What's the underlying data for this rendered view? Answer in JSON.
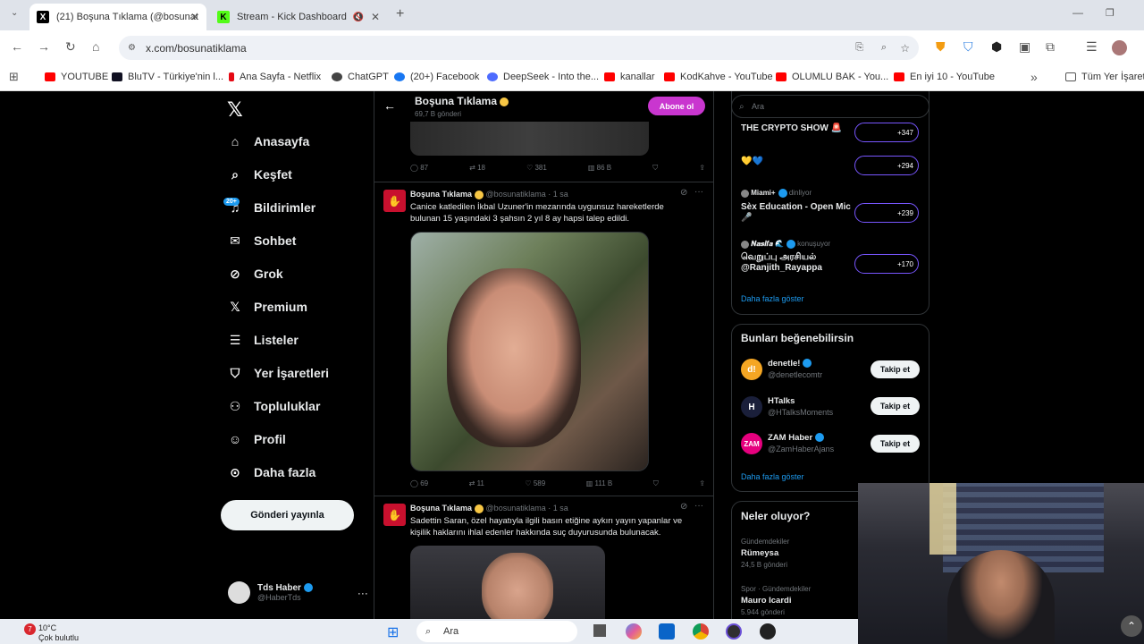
{
  "tabs": [
    {
      "title": "(21) Boşuna Tıklama (@bosunat",
      "active": true
    },
    {
      "title": "Stream - Kick Dashboard",
      "active": false
    }
  ],
  "url": "x.com/bosunatiklama",
  "bookmarks": [
    "YOUTUBE",
    "BluTV - Türkiye'nin l...",
    "Ana Sayfa - Netflix",
    "ChatGPT",
    "(20+) Facebook",
    "DeepSeek - Into the...",
    "kanallar",
    "KodKahve - YouTube",
    "OLUMLU BAK - You...",
    "En iyi 10 - YouTube",
    "Tüm Yer İşaretle"
  ],
  "nav": {
    "items": [
      "Anasayfa",
      "Keşfet",
      "Bildirimler",
      "Sohbet",
      "Grok",
      "Premium",
      "Listeler",
      "Yer İşaretleri",
      "Topluluklar",
      "Profil",
      "Daha fazla"
    ],
    "notif_badge": "20+",
    "post_button": "Gönderi yayınla",
    "account_name": "Tds Haber",
    "account_handle": "@HaberTds"
  },
  "feed": {
    "header_name": "Boşuna Tıklama",
    "header_sub": "69,7 B gönderi",
    "subscribe": "Abone ol",
    "first_actions": [
      "87",
      "18",
      "381",
      "86 B"
    ],
    "tweets": [
      {
        "name": "Boşuna Tıklama",
        "handle": "@bosunatiklama · 1 sa",
        "text": "Canice katledilen İkbal Uzuner'in mezarında uygunsuz hareketlerde bulunan 15 yaşındaki 3 şahsın 2 yıl 8 ay hapsi talep edildi.",
        "actions": [
          "69",
          "11",
          "589",
          "111 B"
        ]
      },
      {
        "name": "Boşuna Tıklama",
        "handle": "@bosunatiklama · 1 sa",
        "text": "Sadettin Saran, özel hayatıyla ilgili basın etiğine aykırı yayın yapanlar ve kişilik haklarını ihlal edenler hakkında suç duyurusunda bulunacak."
      }
    ]
  },
  "right": {
    "search_placeholder": "Ara",
    "spaces": [
      {
        "title": "THE CRYPTO SHOW 🚨",
        "count": "+347"
      },
      {
        "title": "💛💙",
        "count": "+294"
      },
      {
        "host": "Miami+",
        "status": "dinliyor",
        "title": "Sèx Education - Open Mic 🎤",
        "count": "+239"
      },
      {
        "host": "𝑵𝒂𝒔𝒊𝒇𝒂 🌊",
        "status": "konuşuyor",
        "title": "வெறுப்பு அரசியல் @Ranjith_Rayappa",
        "count": "+170"
      }
    ],
    "show_more": "Daha fazla göster",
    "suggest_title": "Bunları beğenebilirsin",
    "suggestions": [
      {
        "name": "denetle!",
        "handle": "@denetlecomtr",
        "button": "Takip et",
        "color": "#f5a623"
      },
      {
        "name": "HTalks",
        "handle": "@HTalksMoments",
        "button": "Takip et",
        "color": "#1a1f3a"
      },
      {
        "name": "ZAM Haber",
        "handle": "@ZamHaberAjans",
        "button": "Takip et",
        "color": "#e6007e"
      }
    ],
    "trends_title": "Neler oluyor?",
    "trends": [
      {
        "cat": "Gündemdekiler",
        "topic": "Rümeysa",
        "count": "24,5 B gönderi"
      },
      {
        "cat": "Spor · Gündemdekiler",
        "topic": "Mauro Icardi",
        "count": "5.944 gönderi"
      }
    ]
  },
  "taskbar": {
    "weather_temp": "10°C",
    "weather_desc": "Çok bulutlu",
    "search": "Ara",
    "alert": "7"
  }
}
